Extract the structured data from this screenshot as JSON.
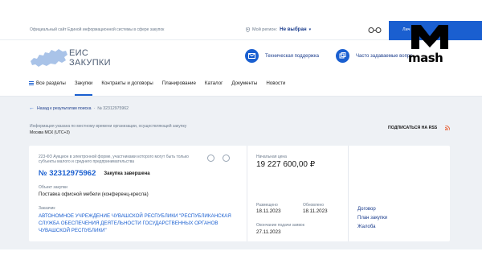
{
  "topbar": {
    "official_site": "Официальный сайт Единой информационной системы в сфере закупок",
    "region_label": "Мой регион:",
    "region_value": "Не выбран",
    "login_label": "Лич"
  },
  "brand": {
    "logo_line1": "ЕИС",
    "logo_line2": "ЗАКУПКИ",
    "support_label": "Техническая поддержка",
    "faq_label": "Часто задаваемые вопро"
  },
  "watermark": "mash",
  "nav": {
    "items": [
      "Все разделы",
      "Закупки",
      "Контракты и договоры",
      "Планирование",
      "Каталог",
      "Документы",
      "Новости"
    ]
  },
  "breadcrumb": {
    "back_label": "Назад к результатам поиска",
    "current": "№ 32312975962"
  },
  "time_info": {
    "line1": "Информация указана по местному времени организации, осуществляющей закупку",
    "line2": "Москва МСК (UTC+3)"
  },
  "rss_label": "ПОДПИСАТЬСЯ НА RSS",
  "purchase": {
    "law_text": "223-ФЗ Аукцион в электронной форме, участниками которого могут быть только субъекты малого и среднего предпринимательства",
    "number": "№ 32312975962",
    "status": "Закупка завершена",
    "object_label": "Объект закупки",
    "object_value": "Поставка офисной мебели (конференц-кресла)",
    "customer_label": "Заказчик",
    "customer_value": "АВТОНОМНОЕ УЧРЕЖДЕНИЕ ЧУВАШСКОЙ РЕСПУБЛИКИ \"РЕСПУБЛИКАНСКАЯ СЛУЖБА ОБЕСПЕЧЕНИЯ ДЕЯТЕЛЬНОСТИ ГОСУДАРСТВЕННЫХ ОРГАНОВ ЧУВАШСКОЙ РЕСПУБЛИКИ\"",
    "price_label": "Начальная цена",
    "price_value": "19 227 600,00 ₽",
    "published_label": "Размещено",
    "published_value": "18.11.2023",
    "updated_label": "Обновлено",
    "updated_value": "18.11.2023",
    "deadline_label": "Окончание подачи заявок",
    "deadline_value": "27.11.2023",
    "links": [
      "Договор",
      "План закупки",
      "Жалоба"
    ]
  },
  "colors": {
    "accent": "#1a5fd0",
    "link": "#1a3c8c",
    "muted": "#6b7a8c",
    "panel": "#eef1f5"
  }
}
